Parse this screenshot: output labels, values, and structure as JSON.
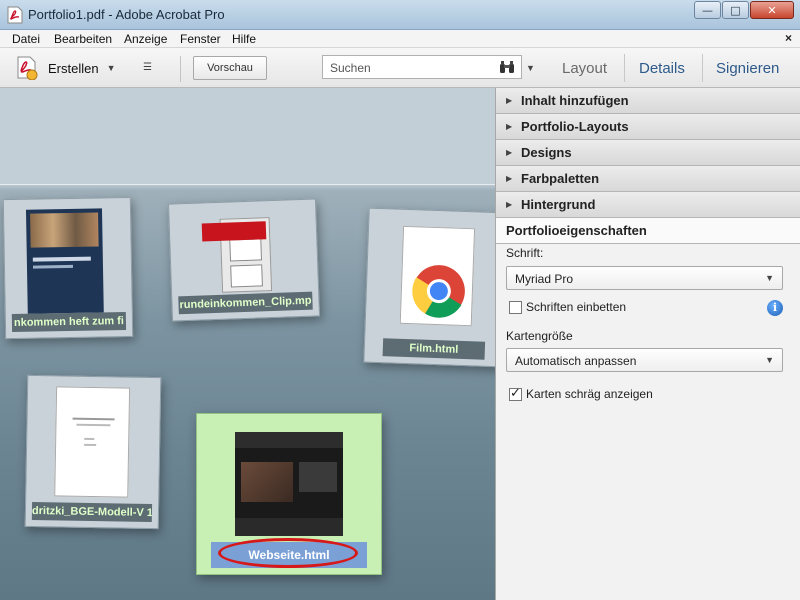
{
  "window": {
    "title": "Portfolio1.pdf - Adobe Acrobat Pro",
    "controls": {
      "minimize": "—",
      "maximize": "□",
      "close": "✕"
    }
  },
  "menu": {
    "items": [
      "Datei",
      "Bearbeiten",
      "Anzeige",
      "Fenster",
      "Hilfe"
    ],
    "close": "×"
  },
  "toolbar": {
    "create_label": "Erstellen",
    "preview_label": "Vorschau",
    "search_placeholder": "Suchen",
    "links": {
      "layout": "Layout",
      "details": "Details",
      "sign": "Signieren"
    }
  },
  "cards": [
    {
      "label": "nkommen heft zum fi"
    },
    {
      "label": "rundeinkommen_Clip.mp"
    },
    {
      "label": "Film.html"
    },
    {
      "label": "dritzki_BGE-Modell-V 1"
    },
    {
      "label": "Webseite.html",
      "selected": true
    }
  ],
  "panel": {
    "sections": [
      "Inhalt hinzufügen",
      "Portfolio-Layouts",
      "Designs",
      "Farbpaletten",
      "Hintergrund"
    ],
    "properties_title": "Portfolioeigenschaften",
    "font_label": "Schrift:",
    "font_value": "Myriad Pro",
    "embed_fonts_label": "Schriften einbetten",
    "embed_fonts_checked": false,
    "card_size_label": "Kartengröße",
    "card_size_value": "Automatisch anpassen",
    "tilt_cards_label": "Karten schräg anzeigen",
    "tilt_cards_checked": true
  },
  "colors": {
    "accent_link": "#2d5a8a",
    "highlight_ellipse": "#d61818",
    "card_label_text": "#dfffc8"
  }
}
